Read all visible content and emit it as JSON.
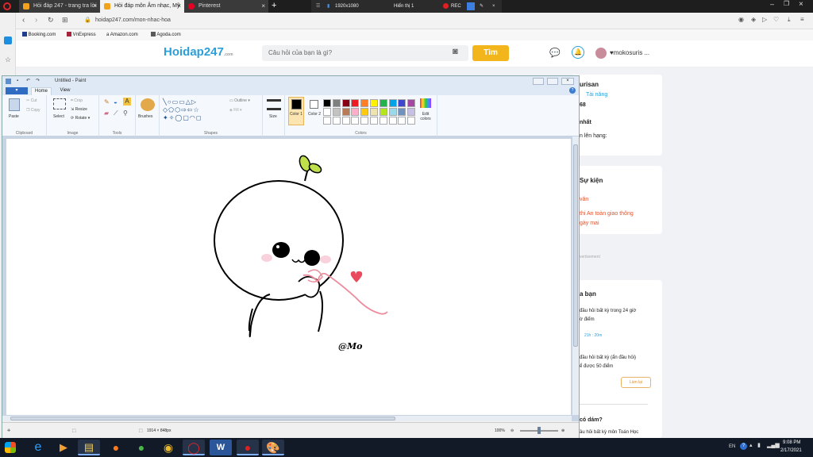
{
  "browser": {
    "tabs": [
      {
        "label": "Hỏi đáp 247 - trang tra lời",
        "active": false
      },
      {
        "label": "Hỏi đáp môn Âm nhạc, Mỹ",
        "active": true
      },
      {
        "label": "Pinterest",
        "active": false
      }
    ],
    "recorder": {
      "resolution": "1920x1080",
      "display": "Hiển thị 1",
      "rec": "REC"
    },
    "url": "hoidap247.com/mon-nhac-hoa",
    "bookmarks": [
      "Booking.com",
      "VnExpress",
      "Amazon.com",
      "Agoda.com"
    ]
  },
  "site": {
    "logo": "Hoidap247",
    "logo_sub": ".com",
    "search_placeholder": "Câu hỏi của bạn là gì?",
    "search_button": "Tìm",
    "username": "♥mokosuris ...",
    "sidebar": {
      "profile_name": "urisan",
      "profile_tag": "Tài năng",
      "points": "68",
      "rank_title": "nhất",
      "rank_text": "n lên hạng:",
      "events_title": "Sự kiện",
      "event1": "văn",
      "event2": "thi An toàn giao thông",
      "event3": "gày mai",
      "advert": "vertisement",
      "tasks_title": "a bạn",
      "task1_line1": "đầu hỏi  bất kỳ  trong 24 giờ",
      "task1_line2": "ờ điểm",
      "task1_time": "21h : 20m",
      "task2_line1": "đầu hỏi  bất kỳ (ẩn đầu hỏi)",
      "task2_line2": "ể được 50 điểm",
      "task_button": "Làm lại",
      "question": "có dám?",
      "question_sub": "ầu hỏi  bất kỳ môn Toán Học"
    }
  },
  "paint": {
    "title": "Untitled - Paint",
    "tabs": {
      "file": "▾",
      "home": "Home",
      "view": "View"
    },
    "groups": {
      "clipboard": "Clipboard",
      "image": "Image",
      "tools": "Tools",
      "shapes": "Shapes",
      "colors": "Colors"
    },
    "buttons": {
      "paste": "Paste",
      "cut": "Cut",
      "copy": "Copy",
      "select": "Select",
      "crop": "Crop",
      "resize": "Resize",
      "rotate": "Rotate",
      "brushes": "Brushes",
      "outline": "Outline",
      "fill": "Fill",
      "size": "Size",
      "color1": "Color 1",
      "color2": "Color 2",
      "edit_colors": "Edit colors"
    },
    "palette": [
      "#000000",
      "#7f7f7f",
      "#880015",
      "#ed1c24",
      "#ff7f27",
      "#fff200",
      "#22b14c",
      "#00a2e8",
      "#3f48cc",
      "#a349a4",
      "#ffffff",
      "#c3c3c3",
      "#b97a57",
      "#ffaec9",
      "#ffc90e",
      "#efe4b0",
      "#b5e61d",
      "#99d9ea",
      "#7092be",
      "#c8bfe7",
      "#ffffff",
      "#ffffff",
      "#ffffff",
      "#ffffff",
      "#ffffff",
      "#ffffff",
      "#ffffff",
      "#ffffff",
      "#ffffff",
      "#ffffff"
    ],
    "canvas_signature": "@Mo",
    "status": {
      "size": "1914 × 848px",
      "zoom": "100%"
    }
  },
  "taskbar": {
    "lang": "EN",
    "time": "9:08 PM",
    "date": "2/17/2021"
  }
}
